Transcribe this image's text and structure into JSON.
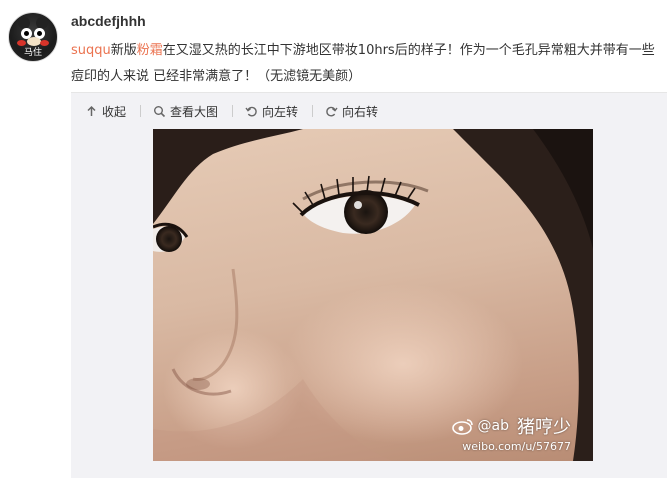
{
  "post": {
    "username": "abcdefjhhh",
    "avatar_caption": "马住",
    "text_link1": "suqqu",
    "text_mid1": "新版",
    "text_link2": "粉霜",
    "text_rest": "在又湿又热的长江中下游地区带妆10hrs后的样子！作为一个毛孔异常粗大并带有一些痘印的人来说 已经非常满意了！（无滤镜无美颜）"
  },
  "toolbar": {
    "collapse_label": "收起",
    "view_large_label": "查看大图",
    "rotate_left_label": "向左转",
    "rotate_right_label": "向右转"
  },
  "watermark": {
    "user": "@ab",
    "brand": "猪哼少",
    "url": "weibo.com/u/57677"
  },
  "icons": [
    "up-arrow-icon",
    "magnifier-icon",
    "rotate-left-icon",
    "rotate-right-icon",
    "weibo-logo-icon"
  ],
  "colors": {
    "link": "#eb7350",
    "media_bg": "#f2f2f5",
    "text": "#333333"
  }
}
